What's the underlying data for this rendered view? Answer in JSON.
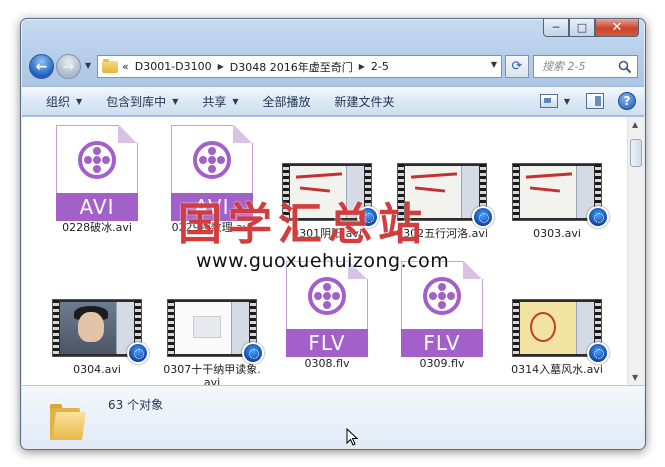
{
  "window": {
    "caption": {
      "minimize": "─",
      "maximize": "□",
      "close": "✕"
    }
  },
  "navigation": {
    "back_icon": "back-arrow-icon",
    "forward_icon": "forward-arrow-icon",
    "breadcrumb_lead": "«",
    "breadcrumb": [
      "D3001-D3100",
      "D3048  2016年虚至奇门",
      "2-5"
    ],
    "search_placeholder": "搜索 2-5"
  },
  "toolbar": {
    "organize": "组织",
    "include_in_library": "包含到库中",
    "share": "共享",
    "play_all": "全部播放",
    "new_folder": "新建文件夹"
  },
  "files": [
    {
      "name": "0228破冰.avi",
      "type": "AVI"
    },
    {
      "name": "0229相数理.avi",
      "type": "AVI"
    },
    {
      "name": "0301阴阳.avi",
      "type": "video"
    },
    {
      "name": "0302五行河洛.avi",
      "type": "video"
    },
    {
      "name": "0303.avi",
      "type": "video"
    },
    {
      "name": "0304.avi",
      "type": "video"
    },
    {
      "name": "0307十干纳甲读象.avi",
      "type": "video"
    },
    {
      "name": "0308.flv",
      "type": "FLV"
    },
    {
      "name": "0309.flv",
      "type": "FLV"
    },
    {
      "name": "0314入墓风水.avi",
      "type": "video"
    }
  ],
  "watermark": {
    "title": "国学汇总站",
    "url": "www.guoxuehuizong.com"
  },
  "status": {
    "object_count": "63 个对象"
  },
  "colors": {
    "media_purple": "#a360c9",
    "window_frame": "#b5cde9",
    "watermark_red": "#c81414"
  }
}
